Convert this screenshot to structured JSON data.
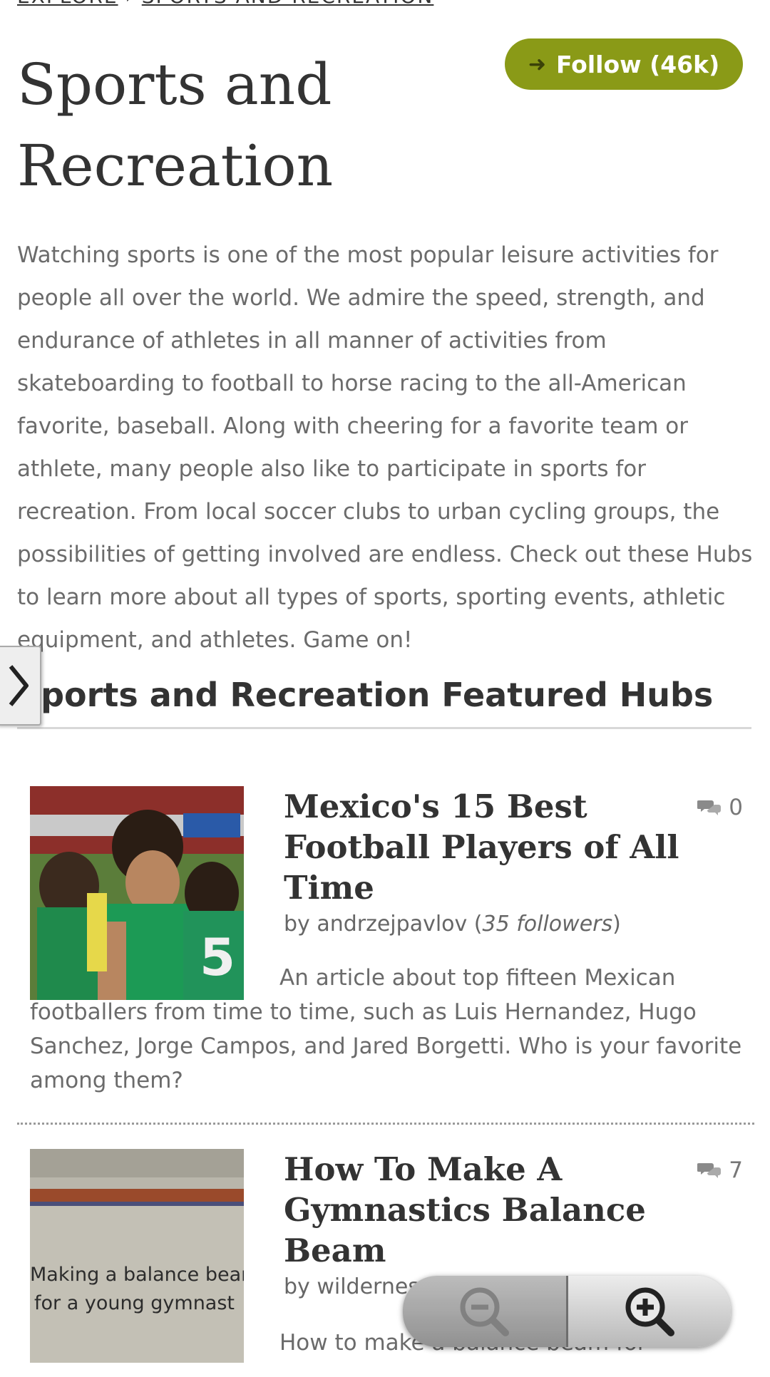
{
  "breadcrumb": {
    "explore": "EXPLORE",
    "separator": "›",
    "current": "SPORTS AND RECREATION"
  },
  "page": {
    "title": "Sports and Recreation",
    "follow_label": "Follow (46k)",
    "description": "Watching sports is one of the most popular leisure activities for people all over the world. We admire the speed, strength, and endurance of athletes in all manner of activities from skateboarding to football to horse racing to the all-American favorite, baseball. Along with cheering for a favorite team or athlete, many people also like to participate in sports for recreation. From local soccer clubs to urban cycling groups, the possibilities of getting involved are endless. Check out these Hubs to learn more about all types of sports, sporting events, athletic equipment, and athletes. Game on!"
  },
  "featured": {
    "heading": "Sports and Recreation Featured Hubs",
    "hubs": [
      {
        "title": "Mexico's 15 Best Football Players of All Time",
        "by": "by andrzejpavlov (",
        "followers": "35 followers",
        "close": ")",
        "comments": "0",
        "summary": "An article about top fifteen Mexican footballers from time to time, such as Luis Hernandez, Hugo Sanchez, Jorge Campos, and Jared Borgetti. Who is your favorite among them?"
      },
      {
        "title": "How To Make A Gymnastics Balance Beam",
        "by": "by wildernes",
        "comments": "7",
        "thumb_text_1": "Making a balance beam",
        "thumb_text_2": "for a young gymnast",
        "summary": "How to make a balance beam for"
      }
    ]
  },
  "icons": {
    "follow": "arrow-right-icon",
    "comment": "comment-bubbles-icon",
    "side_tab": "chevron-right-icon",
    "zoom_out": "zoom-out-icon",
    "zoom_in": "zoom-in-icon"
  },
  "colors": {
    "follow_bg": "#8a9a17",
    "text": "#333333",
    "muted": "#6b6b6b"
  }
}
